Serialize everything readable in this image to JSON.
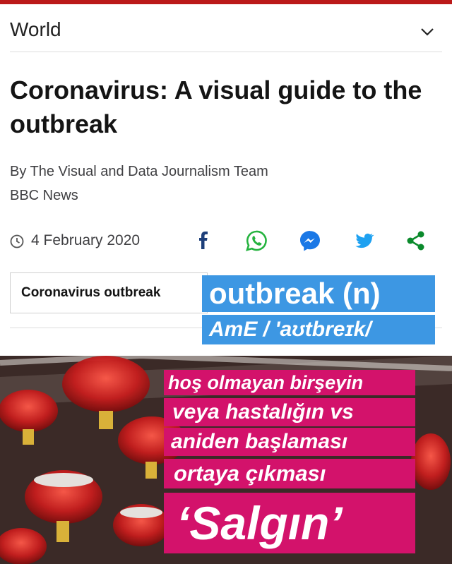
{
  "header": {
    "section_title": "World",
    "accent_color": "#bb1919"
  },
  "article": {
    "headline": "Coronavirus: A visual guide to the outbreak",
    "byline": "By The Visual and Data Journalism Team",
    "outlet": "BBC News",
    "date": "4 February 2020",
    "tag": "Coronavirus outbreak"
  },
  "share": {
    "icons": [
      "facebook-icon",
      "whatsapp-icon",
      "messenger-icon",
      "twitter-icon",
      "share-icon"
    ]
  },
  "overlay": {
    "word": "outbreak (n)",
    "pronunciation": "AmE / 'aʊtbreɪk/",
    "definition_lines": [
      "hoş olmayan birşeyin",
      "veya hastalığın vs",
      "aniden başlaması",
      "ortaya çıkması"
    ],
    "translation": "‘Salgın’",
    "blue_color": "#3d97e3",
    "pink_color": "#d3126b"
  }
}
